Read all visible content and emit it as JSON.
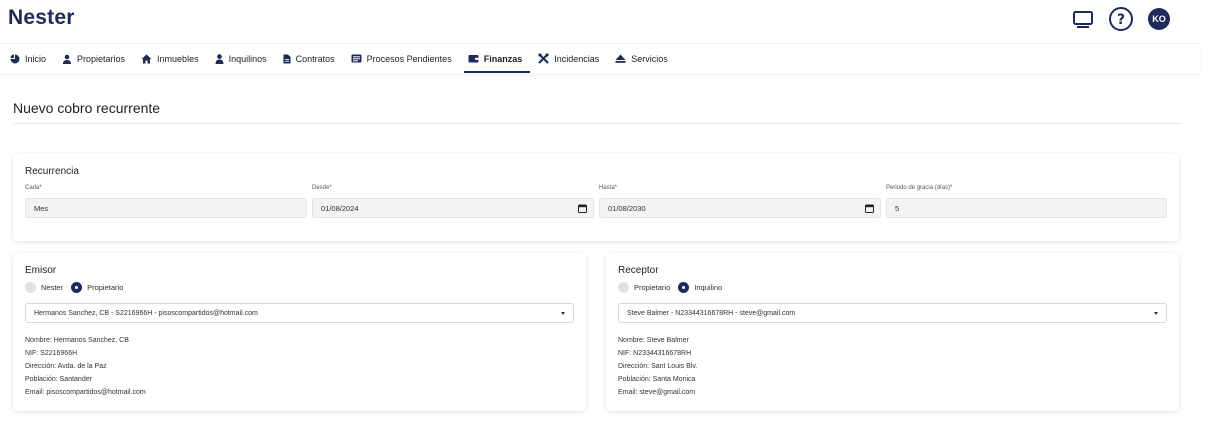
{
  "app": {
    "brand": "Nester",
    "avatar_initials": "KO"
  },
  "top_icons": [
    "monitor-icon",
    "help-icon"
  ],
  "nav": {
    "tabs": [
      {
        "label": "Inicio",
        "icon": "chart-pie-icon"
      },
      {
        "label": "Propietarios",
        "icon": "user-tie-icon"
      },
      {
        "label": "Inmuebles",
        "icon": "house-icon"
      },
      {
        "label": "Inquilinos",
        "icon": "user-icon"
      },
      {
        "label": "Contratos",
        "icon": "document-icon"
      },
      {
        "label": "Procesos Pendientes",
        "icon": "list-icon"
      },
      {
        "label": "Finanzas",
        "icon": "wallet-icon",
        "active": true
      },
      {
        "label": "Incidencias",
        "icon": "tools-icon"
      },
      {
        "label": "Servicios",
        "icon": "eject-icon"
      }
    ]
  },
  "page": {
    "title": "Nuevo cobro recurrente"
  },
  "recurrencia": {
    "title": "Recurrencia",
    "cada": {
      "label": "Cada*",
      "value": "Mes"
    },
    "desde": {
      "label": "Desde*",
      "value": "01/08/2024"
    },
    "hasta": {
      "label": "Hasta*",
      "value": "01/08/2030"
    },
    "gracia": {
      "label": "Periodo de gracia (días)*",
      "value": "5"
    }
  },
  "emisor": {
    "title": "Emisor",
    "options": [
      {
        "label": "Nester",
        "selected": false
      },
      {
        "label": "Propietario",
        "selected": true
      }
    ],
    "select_value": "Hermanos Sanchez, CB - S2216966H - pisoscompartidos@hotmail.com",
    "info": [
      "Nombre: Hermanos Sanchez, CB",
      "NIF: S2216966H",
      "Dirección: Avda. de la Paz",
      "Población: Santander",
      "Email: pisoscompartidos@hotmail.com"
    ]
  },
  "receptor": {
    "title": "Receptor",
    "options": [
      {
        "label": "Propietario",
        "selected": false
      },
      {
        "label": "Inquilino",
        "selected": true
      }
    ],
    "select_value": "Steve Balmer - N23344316678RH - steve@gmail.com",
    "info": [
      "Nombre: Steve Balmer",
      "NIF: N23344316678RH",
      "Dirección: Sant Louis Blv.",
      "Población: Santa Monica",
      "Email: steve@gmail.com"
    ]
  },
  "colors": {
    "brand": "#1e2a5a",
    "field_bg": "#f2f3f5"
  }
}
